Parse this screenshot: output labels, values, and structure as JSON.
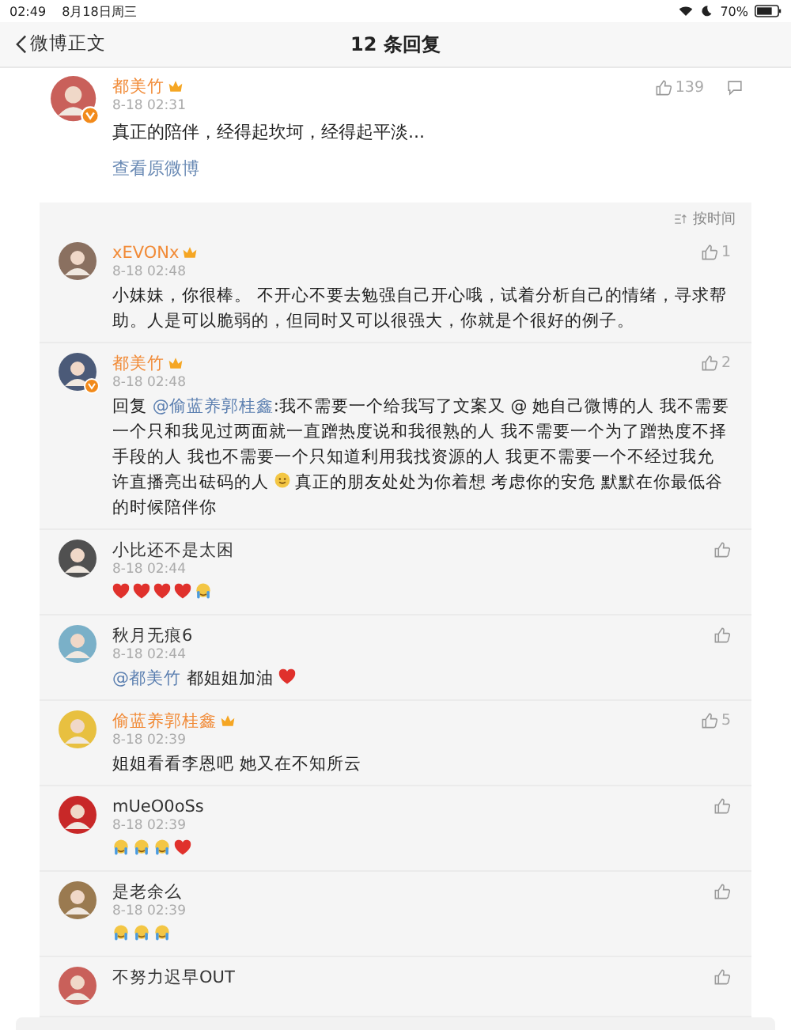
{
  "status_bar": {
    "time": "02:49",
    "date": "8月18日周三",
    "battery": "70%"
  },
  "nav": {
    "back": "微博正文",
    "title": "12 条回复"
  },
  "post": {
    "name": "都美竹",
    "vip": true,
    "verified": true,
    "time": "8-18 02:31",
    "likes": "139",
    "text": "真正的陪伴，经得起坎坷，经得起平淡...",
    "link": "查看原微博"
  },
  "sort": {
    "label": "按时间"
  },
  "comments": [
    {
      "name": "xEVONx",
      "vip": true,
      "verified": false,
      "time": "8-18 02:48",
      "likes": "1",
      "content": [
        {
          "kind": "text",
          "text": "小妹妹，你很棒。 不开心不要去勉强自己开心哦，试着分析自己的情绪，寻求帮助。人是可以脆弱的，但同时又可以很强大，你就是个很好的例子。"
        }
      ]
    },
    {
      "name": "都美竹",
      "vip": true,
      "verified": true,
      "time": "8-18 02:48",
      "likes": "2",
      "content": [
        {
          "kind": "text",
          "text": "回复 "
        },
        {
          "kind": "mention",
          "text": "@偷蓝养郭桂鑫"
        },
        {
          "kind": "text",
          "text": ":我不需要一个给我写了文案又 @ 她自己微博的人 我不需要一个只和我见过两面就一直蹭热度说和我很熟的人 我不需要一个为了蹭热度不择手段的人 我也不需要一个只知道利用我找资源的人 我更不需要一个不经过我允许直播亮出砝码的人 "
        },
        {
          "kind": "smile"
        },
        {
          "kind": "text",
          "text": "真正的朋友处处为你着想 考虑你的安危 默默在你最低谷的时候陪伴你"
        }
      ]
    },
    {
      "name": "小比还不是太困",
      "vip": false,
      "verified": false,
      "time": "8-18 02:44",
      "content": [
        {
          "kind": "heart"
        },
        {
          "kind": "heart"
        },
        {
          "kind": "heart"
        },
        {
          "kind": "heart"
        },
        {
          "kind": "tears"
        }
      ]
    },
    {
      "name": "秋月无痕6",
      "vip": false,
      "verified": false,
      "time": "8-18 02:44",
      "content": [
        {
          "kind": "mention",
          "text": "@都美竹"
        },
        {
          "kind": "text",
          "text": " 都姐姐加油 "
        },
        {
          "kind": "heart"
        }
      ]
    },
    {
      "name": "偷蓝养郭桂鑫",
      "vip": true,
      "verified": false,
      "time": "8-18 02:39",
      "likes": "5",
      "content": [
        {
          "kind": "text",
          "text": "姐姐看看李恩吧 她又在不知所云"
        }
      ]
    },
    {
      "name": "mUeO0oSs",
      "vip": false,
      "verified": false,
      "time": "8-18 02:39",
      "content": [
        {
          "kind": "tears"
        },
        {
          "kind": "tears"
        },
        {
          "kind": "tears"
        },
        {
          "kind": "heart"
        }
      ]
    },
    {
      "name": "是老余么",
      "vip": false,
      "verified": false,
      "time": "8-18 02:39",
      "content": [
        {
          "kind": "tears"
        },
        {
          "kind": "tears"
        },
        {
          "kind": "tears"
        }
      ]
    },
    {
      "name": "不努力迟早OUT",
      "vip": false,
      "verified": false
    }
  ]
}
